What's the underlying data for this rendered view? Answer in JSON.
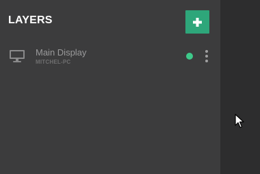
{
  "panel": {
    "title": "LAYERS",
    "add_button_icon": "plus-icon"
  },
  "layers": [
    {
      "name": "Main Display",
      "machine": "MITCHEL-PC",
      "icon": "monitor-icon",
      "status_color": "#3ec98a"
    }
  ],
  "colors": {
    "accent": "#2ea67a",
    "status_online": "#3ec98a",
    "panel_bg": "#3c3c3d",
    "app_bg": "#2d2d2e"
  }
}
